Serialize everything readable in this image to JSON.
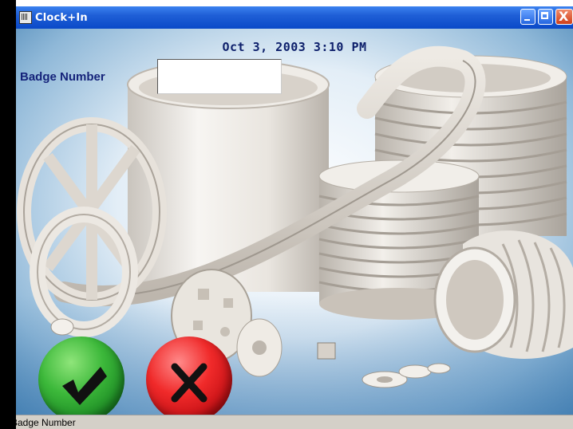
{
  "window": {
    "title": "Clock+In",
    "icon": "clock-app-icon",
    "controls": [
      "minimize-icon",
      "maximize-icon",
      "close-icon"
    ],
    "close_glyph": "X"
  },
  "header": {
    "datetime": "Oct 3, 2003 3:10 PM"
  },
  "form": {
    "badge_label": "Badge Number",
    "badge_value": "",
    "badge_placeholder": ""
  },
  "actions": {
    "ok_icon": "checkmark-icon",
    "cancel_icon": "x-cross-icon"
  },
  "background": {
    "image": "ceramic-parts-photo"
  },
  "statusbar": {
    "text": "Badge Number"
  },
  "colors": {
    "titlebar": "#0a49c8",
    "label_text": "#15237a",
    "ok_green": "#2aa52e",
    "cancel_red": "#e01a1e",
    "statusbar_bg": "#d4d0c8"
  }
}
